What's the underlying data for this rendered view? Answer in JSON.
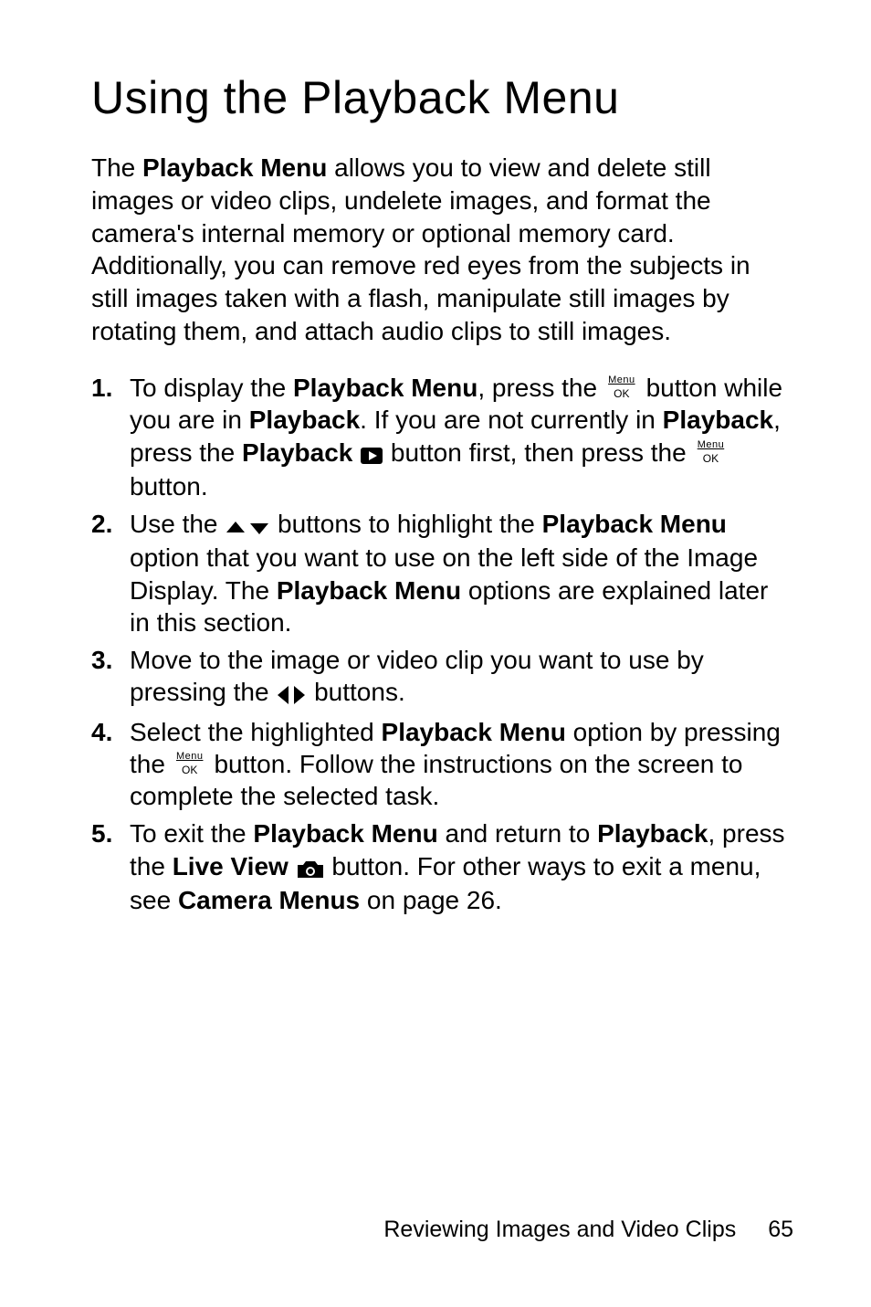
{
  "title": "Using the Playback Menu",
  "intro": {
    "t1": "The ",
    "b1": "Playback Menu",
    "t2": " allows you to view and delete still images or video clips, undelete images, and format the camera's internal memory or optional memory card. Additionally, you can remove red eyes from the subjects in still images taken with a flash, manipulate still images by rotating them, and attach audio clips to still images."
  },
  "steps": {
    "s1": {
      "num": "1.",
      "t1": "To display the ",
      "b1": "Playback Menu",
      "t2": ", press the ",
      "t3": " button while you are in ",
      "b2": "Playback",
      "t4": ". If you are not currently in ",
      "b3": "Playback",
      "t5": ", press the ",
      "b4": "Playback",
      "t6": " ",
      "t7": " button first, then press the ",
      "t8": " button."
    },
    "s2": {
      "num": "2.",
      "t1": "Use the ",
      "t2": " buttons to highlight the ",
      "b1": "Playback Menu",
      "t3": " option that you want to use on the left side of the Image Display. The ",
      "b2": "Playback Menu",
      "t4": " options are explained later in this section."
    },
    "s3": {
      "num": "3.",
      "t1": "Move to the image or video clip you want to use by pressing the ",
      "t2": " buttons."
    },
    "s4": {
      "num": "4.",
      "t1": "Select the highlighted ",
      "b1": "Playback Menu",
      "t2": " option by pressing the ",
      "t3": " button. Follow the instructions on the screen to complete the selected task."
    },
    "s5": {
      "num": "5.",
      "t1": "To exit the ",
      "b1": "Playback Menu",
      "t2": " and return to ",
      "b2": "Playback",
      "t3": ", press the ",
      "b3": "Live View",
      "t4": " ",
      "t5": " button. For other ways to exit a menu, see ",
      "b4": "Camera Menus",
      "t6": " on page 26."
    }
  },
  "icons": {
    "menuok_top": "Menu",
    "menuok_bot": "OK"
  },
  "footer": {
    "text": "Reviewing Images and Video Clips",
    "page": "65"
  }
}
